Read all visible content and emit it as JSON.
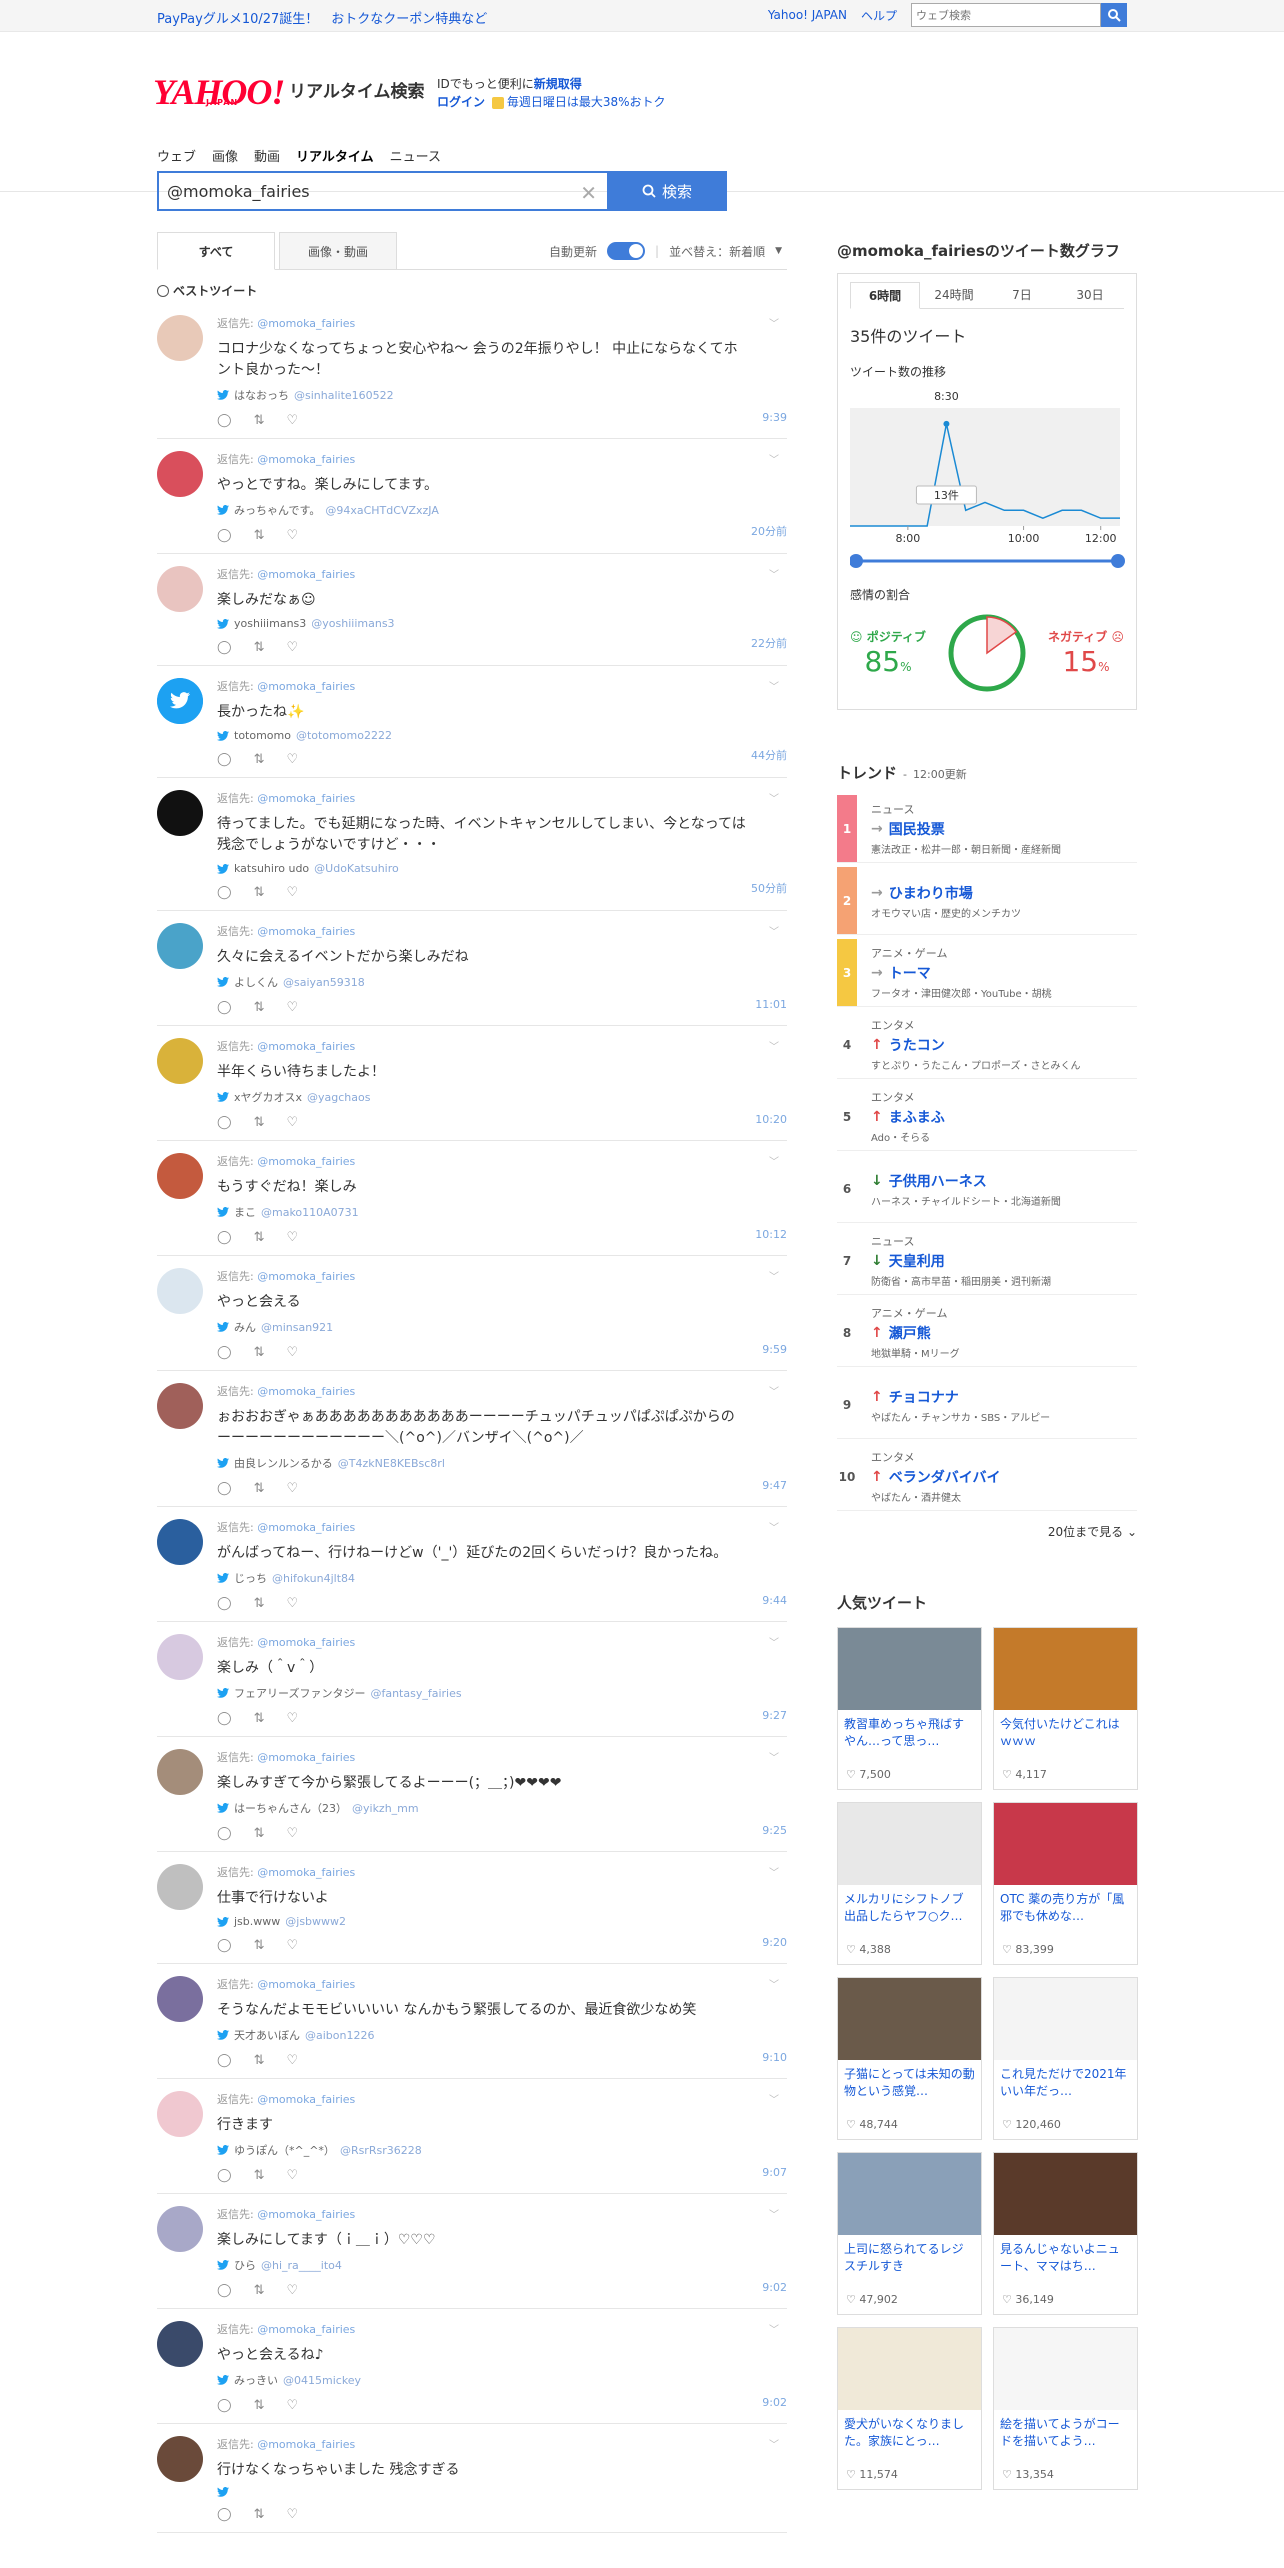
{
  "topbar": {
    "promo": "PayPayグルメ10/27誕生！　おトクなクーポン特典など",
    "links": [
      "Yahoo! JAPAN",
      "ヘルプ"
    ],
    "search_placeholder": "ウェブ検索"
  },
  "header": {
    "logo": "YAHOO!",
    "logo_sub": "JAPAN",
    "service": "リアルタイム検索",
    "id_text": "IDでもっと便利に",
    "id_link": "新規取得",
    "login": "ログイン",
    "promo": "毎週日曜日は最大38%おトク"
  },
  "nav": [
    "ウェブ",
    "画像",
    "動画",
    "リアルタイム",
    "ニュース"
  ],
  "search": {
    "query": "@momoka_fairies",
    "button": "検索"
  },
  "tabs": {
    "all": "すべて",
    "media": "画像・動画",
    "auto": "自動更新",
    "sort": "並べ替え：新着順"
  },
  "best_label": "ベストツイート",
  "reply_prefix": "返信先:",
  "reply_to": "@momoka_fairies",
  "tweets": [
    {
      "text": "コロナ少なくなってちょっと安心やね〜 会うの2年振りやし！ 中止にならなくてホント良かった〜！",
      "name": "はなおっち",
      "handle": "@sinhalite160522",
      "time": "9:39"
    },
    {
      "text": "やっとですね。楽しみにしてます。",
      "name": "みっちゃんです。",
      "handle": "@94xaCHTdCVZxzJA",
      "time": "20分前"
    },
    {
      "text": "楽しみだなぁ☺",
      "name": "yoshiiimans3",
      "handle": "@yoshiiimans3",
      "time": "22分前"
    },
    {
      "text": "長かったね✨",
      "name": "totomomo",
      "handle": "@totomomo2222",
      "time": "44分前"
    },
    {
      "text": "待ってました。でも延期になった時、イベントキャンセルしてしまい、今となっては残念でしょうがないですけど・・・",
      "name": "katsuhiro udo",
      "handle": "@UdoKatsuhiro",
      "time": "50分前"
    },
    {
      "text": "久々に会えるイベントだから楽しみだね",
      "name": "よしくん",
      "handle": "@saiyan59318",
      "time": "11:01"
    },
    {
      "text": "半年くらい待ちましたよ！",
      "name": "xヤグカオスx",
      "handle": "@yagchaos",
      "time": "10:20"
    },
    {
      "text": "もうすぐだね！楽しみ",
      "name": "まこ",
      "handle": "@mako110A0731",
      "time": "10:12"
    },
    {
      "text": "やっと会える",
      "name": "みん",
      "handle": "@minsan921",
      "time": "9:59"
    },
    {
      "text": "ぉおおおぎゃぁあああああああああああーーーーチュッパチュッパぱぷぱぷからのーーーーーーーーーーーー＼(^o^)／バンザイ＼(^o^)／",
      "name": "由良レンルンるかる",
      "handle": "@T4zkNE8KEBsc8rl",
      "time": "9:47"
    },
    {
      "text": "がんばってねー、行けねーけどw（'_'）延びたの2回くらいだっけ？良かったね。",
      "name": "じっち",
      "handle": "@hifokun4jlt84",
      "time": "9:44"
    },
    {
      "text": "楽しみ（＾v＾）",
      "name": "フェアリーズファンタジー",
      "handle": "@fantasy_fairies",
      "time": "9:27"
    },
    {
      "text": "楽しみすぎて今から緊張してるよーーー(；＿；)❤❤❤❤",
      "name": "はーちゃんさん（23）",
      "handle": "@yikzh_mm",
      "time": "9:25"
    },
    {
      "text": "仕事で行けないよ",
      "name": "jsb.www",
      "handle": "@jsbwww2",
      "time": "9:20"
    },
    {
      "text": "そうなんだよモモビいいいい なんかもう緊張してるのか、最近食欲少なめ笑",
      "name": "天才あいぼん",
      "handle": "@aibon1226",
      "time": "9:10"
    },
    {
      "text": "行きます",
      "name": "ゆうぽん（*^_^*）",
      "handle": "@RsrRsr36228",
      "time": "9:07"
    },
    {
      "text": "楽しみにしてます（ｉ＿ｉ）♡♡♡",
      "name": "ひら",
      "handle": "@hi_ra____ito4",
      "time": "9:02"
    },
    {
      "text": "やっと会えるね♪",
      "name": "みっきい",
      "handle": "@0415mickey",
      "time": "9:02"
    },
    {
      "text": "行けなくなっちゃいました 残念すぎる",
      "name": "",
      "handle": "",
      "time": ""
    }
  ],
  "graph": {
    "title": "@momoka_fairiesのツイート数グラフ",
    "tabs": [
      "6時間",
      "24時間",
      "7日",
      "30日"
    ],
    "count": "35件のツイート",
    "trend_label": "ツイート数の推移",
    "peak_time": "8:30",
    "peak_value": "13件",
    "xticks": [
      "8:00",
      "10:00",
      "12:00"
    ],
    "sentiment_label": "感情の割合",
    "positive_label": "ポジティブ",
    "positive": "85",
    "negative_label": "ネガティブ",
    "negative": "15",
    "pct": "%"
  },
  "chart_data": {
    "type": "line",
    "x": [
      "6:30",
      "7:00",
      "7:30",
      "8:00",
      "8:15",
      "8:30",
      "8:45",
      "9:00",
      "9:30",
      "10:00",
      "10:30",
      "11:00",
      "11:30",
      "12:00",
      "12:15"
    ],
    "values": [
      0,
      0,
      0,
      0,
      0,
      13,
      2,
      3,
      2,
      2,
      1,
      2,
      2,
      1,
      1
    ],
    "ylim": [
      0,
      14
    ]
  },
  "trend": {
    "title": "トレンド",
    "updated": "12:00更新",
    "more": "20位まで見る",
    "items": [
      {
        "rank": "1",
        "cat": "ニュース",
        "name": "国民投票",
        "sub": "憲法改正・松井一郎・朝日新聞・産経新聞",
        "dir": "→",
        "color": "#f37b8a"
      },
      {
        "rank": "2",
        "cat": "",
        "name": "ひまわり市場",
        "sub": "オモウマい店・歴史的メンチカツ",
        "dir": "→",
        "color": "#f5a273"
      },
      {
        "rank": "3",
        "cat": "アニメ・ゲーム",
        "name": "トーマ",
        "sub": "フータオ・津田健次郎・YouTube・胡桃",
        "dir": "→",
        "color": "#f5c842"
      },
      {
        "rank": "4",
        "cat": "エンタメ",
        "name": "うたコン",
        "sub": "すとぷり・うたこん・プロポーズ・さとみくん",
        "dir": "↑",
        "color": ""
      },
      {
        "rank": "5",
        "cat": "エンタメ",
        "name": "まふまふ",
        "sub": "Ado・そらる",
        "dir": "↑",
        "color": ""
      },
      {
        "rank": "6",
        "cat": "",
        "name": "子供用ハーネス",
        "sub": "ハーネス・チャイルドシート・北海道新聞",
        "dir": "↓",
        "color": ""
      },
      {
        "rank": "7",
        "cat": "ニュース",
        "name": "天皇利用",
        "sub": "防衛省・高市早苗・稲田朋美・週刊新潮",
        "dir": "↓",
        "color": ""
      },
      {
        "rank": "8",
        "cat": "アニメ・ゲーム",
        "name": "瀬戸熊",
        "sub": "地獄単騎・Mリーグ",
        "dir": "↑",
        "color": ""
      },
      {
        "rank": "9",
        "cat": "",
        "name": "チョコナナ",
        "sub": "やばたん・チャンサカ・SBS・アルピー",
        "dir": "↑",
        "color": ""
      },
      {
        "rank": "10",
        "cat": "エンタメ",
        "name": "ベランダバイバイ",
        "sub": "やばたん・酒井健太",
        "dir": "↑",
        "color": ""
      }
    ]
  },
  "popular": {
    "title": "人気ツイート",
    "items": [
      {
        "cap": "教習車めっちゃ飛ばすやん…って思っ…",
        "likes": "7,500"
      },
      {
        "cap": "今気付いたけどこれはｗｗｗ",
        "likes": "4,117"
      },
      {
        "cap": "メルカリにシフトノブ出品したらヤフ○ク…",
        "likes": "4,388"
      },
      {
        "cap": "OTC 薬の売り方が「風邪でも休めな…",
        "likes": "83,399"
      },
      {
        "cap": "子猫にとっては未知の動物という感覚…",
        "likes": "48,744"
      },
      {
        "cap": "これ見ただけで2021年いい年だっ…",
        "likes": "120,460"
      },
      {
        "cap": "上司に怒られてるレジスチルすき",
        "likes": "47,902"
      },
      {
        "cap": "見るんじゃないよニュート、ママはち…",
        "likes": "36,149"
      },
      {
        "cap": "愛犬がいなくなりました。家族にとっ…",
        "likes": "11,574"
      },
      {
        "cap": "絵を描いてようがコードを描いてよう…",
        "likes": "13,354"
      }
    ]
  },
  "colors": {
    "accent": "#3f7cd9",
    "logo": "#ff0033",
    "positive": "#2ea84a",
    "negative": "#e04848"
  }
}
